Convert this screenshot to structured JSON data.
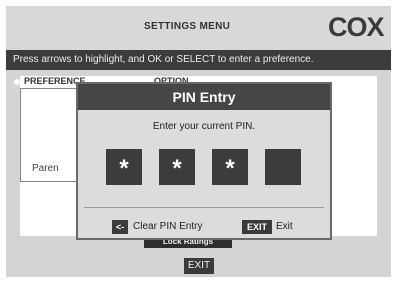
{
  "header": {
    "title": "SETTINGS MENU",
    "logo_text": "COX"
  },
  "instructions": "Press arrows to highlight, and OK or SELECT to enter a preference.",
  "columns": {
    "preference": "PREFERENCE",
    "option": "OPTION"
  },
  "preferences": {
    "visible_item": "Paren"
  },
  "lock_button_label": "Lock Ratings",
  "exit_button_label": "EXIT",
  "modal": {
    "title": "PIN Entry",
    "prompt": "Enter your current PIN.",
    "pin_digits": [
      "*",
      "*",
      "*",
      ""
    ],
    "clear_key": "<-",
    "clear_label": "Clear PIN Entry",
    "exit_key": "EXIT",
    "exit_label": "Exit"
  }
}
